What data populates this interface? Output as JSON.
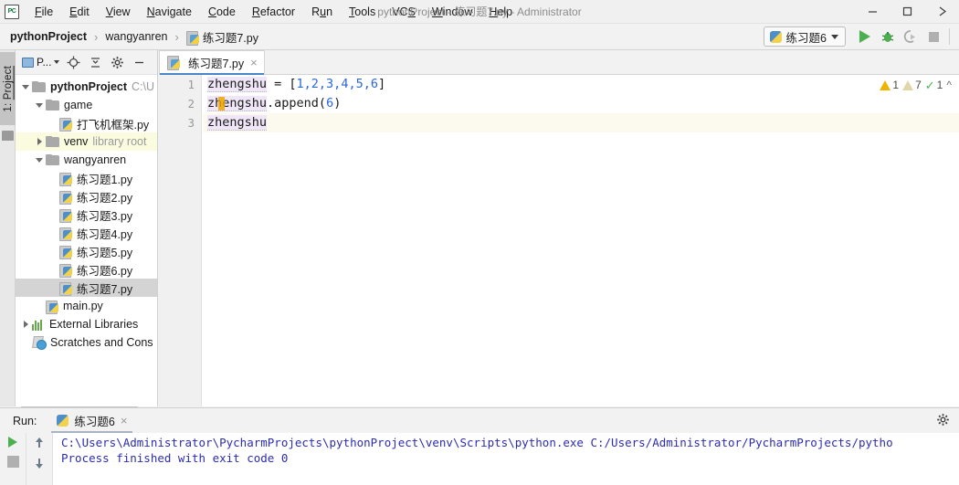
{
  "window": {
    "title": "pythonProject - 练习题7.py - Administrator",
    "logo_text": "PC",
    "minimize_icon": "minimize-icon",
    "maximize_icon": "maximize-icon",
    "close_icon": "close-icon"
  },
  "menu": {
    "items": [
      {
        "label": "File",
        "mnemonic": "F",
        "rest": "ile"
      },
      {
        "label": "Edit",
        "mnemonic": "E",
        "rest": "dit"
      },
      {
        "label": "View",
        "mnemonic": "V",
        "rest": "iew"
      },
      {
        "label": "Navigate",
        "mnemonic": "N",
        "rest": "avigate"
      },
      {
        "label": "Code",
        "mnemonic": "C",
        "rest": "ode"
      },
      {
        "label": "Refactor",
        "mnemonic": "R",
        "rest": "efactor"
      },
      {
        "label": "Run",
        "pre": "R",
        "mnemonic": "u",
        "rest": "n"
      },
      {
        "label": "Tools",
        "mnemonic": "T",
        "rest": "ools"
      },
      {
        "label": "VCS",
        "pre": "VC",
        "mnemonic": "S",
        "rest": ""
      },
      {
        "label": "Window",
        "mnemonic": "W",
        "rest": "indow"
      },
      {
        "label": "Help",
        "mnemonic": "H",
        "rest": "elp"
      }
    ]
  },
  "breadcrumb": {
    "project": "pythonProject",
    "folder": "wangyanren",
    "file": "练习题7.py",
    "separator": "›"
  },
  "run_toolbar": {
    "configuration": "练习题6",
    "run_icon": "run-icon",
    "debug_icon": "debug-icon",
    "coverage_icon": "run-with-coverage-icon",
    "stop_icon": "stop-icon"
  },
  "tool_strip": {
    "project_tab": "1: Project",
    "project_tab_number": "1",
    "project_tab_name": "Project"
  },
  "project_panel": {
    "selector_label": "P...",
    "icons": [
      "locate-icon",
      "collapse-all-icon",
      "settings-icon",
      "hide-icon"
    ],
    "tree": [
      {
        "name": "pythonProject",
        "sub": "C:\\U",
        "type": "folder",
        "depth": 0,
        "twist": "down",
        "bold": true,
        "selected": false,
        "library": false
      },
      {
        "name": "game",
        "sub": "",
        "type": "folder",
        "depth": 1,
        "twist": "down",
        "bold": false,
        "selected": false,
        "library": false
      },
      {
        "name": "打飞机框架.py",
        "sub": "",
        "type": "python",
        "depth": 2,
        "twist": "none",
        "bold": false,
        "selected": false,
        "library": false
      },
      {
        "name": "venv",
        "sub": "library root",
        "type": "folder",
        "depth": 1,
        "twist": "right",
        "bold": false,
        "selected": false,
        "library": true
      },
      {
        "name": "wangyanren",
        "sub": "",
        "type": "folder",
        "depth": 1,
        "twist": "down",
        "bold": false,
        "selected": false,
        "library": false
      },
      {
        "name": "练习题1.py",
        "sub": "",
        "type": "python",
        "depth": 2,
        "twist": "none",
        "bold": false,
        "selected": false,
        "library": false
      },
      {
        "name": "练习题2.py",
        "sub": "",
        "type": "python",
        "depth": 2,
        "twist": "none",
        "bold": false,
        "selected": false,
        "library": false
      },
      {
        "name": "练习题3.py",
        "sub": "",
        "type": "python",
        "depth": 2,
        "twist": "none",
        "bold": false,
        "selected": false,
        "library": false
      },
      {
        "name": "练习题4.py",
        "sub": "",
        "type": "python",
        "depth": 2,
        "twist": "none",
        "bold": false,
        "selected": false,
        "library": false
      },
      {
        "name": "练习题5.py",
        "sub": "",
        "type": "python",
        "depth": 2,
        "twist": "none",
        "bold": false,
        "selected": false,
        "library": false
      },
      {
        "name": "练习题6.py",
        "sub": "",
        "type": "python",
        "depth": 2,
        "twist": "none",
        "bold": false,
        "selected": false,
        "library": false
      },
      {
        "name": "练习题7.py",
        "sub": "",
        "type": "python",
        "depth": 2,
        "twist": "none",
        "bold": false,
        "selected": true,
        "library": false
      },
      {
        "name": "main.py",
        "sub": "",
        "type": "python",
        "depth": 1,
        "twist": "none",
        "bold": false,
        "selected": false,
        "library": false
      },
      {
        "name": "External Libraries",
        "sub": "",
        "type": "library",
        "depth": 0,
        "twist": "right",
        "bold": false,
        "selected": false,
        "library": false
      },
      {
        "name": "Scratches and Cons",
        "sub": "",
        "type": "scratch",
        "depth": 0,
        "twist": "none",
        "bold": false,
        "selected": false,
        "library": false
      }
    ]
  },
  "editor": {
    "tab": {
      "label": "练习题7.py",
      "close": "×"
    },
    "lines": [
      {
        "number": "1",
        "text": "zhengshu = [1,2,3,4,5,6]"
      },
      {
        "number": "2",
        "text": "zhengshu.append(6)"
      },
      {
        "number": "3",
        "text": "zhengshu"
      }
    ],
    "code": {
      "l1_var": "zhengshu",
      "l1_eq": " = [",
      "l1_nums": "1,2,3,4,5,6",
      "l1_close": "]",
      "l2_var": "zhengshu",
      "l2_call": ".append(",
      "l2_num": "6",
      "l2_close": ")",
      "l3_var": "zhengshu"
    },
    "inspections": {
      "warning_count": "1",
      "weak_warning_count": "7",
      "ok_count": "1",
      "collapse_icon": "chevron-up-icon"
    }
  },
  "run_panel": {
    "label": "Run:",
    "tab": "练习题6",
    "tab_close": "×",
    "settings_icon": "gear-icon",
    "buttons": [
      "rerun-icon",
      "stop-icon",
      "scroll-up-icon",
      "scroll-down-icon"
    ],
    "console": [
      "C:\\Users\\Administrator\\PycharmProjects\\pythonProject\\venv\\Scripts\\python.exe C:/Users/Administrator/PycharmProjects/pytho",
      "",
      "Process finished with exit code 0"
    ]
  },
  "colors": {
    "accent_blue": "#4a86c8",
    "run_green": "#4caf50",
    "warning_yellow": "#f0b400",
    "console_text": "#2c2cb0",
    "selection_gray": "#d4d4d4",
    "library_row": "#fbfbe0"
  }
}
